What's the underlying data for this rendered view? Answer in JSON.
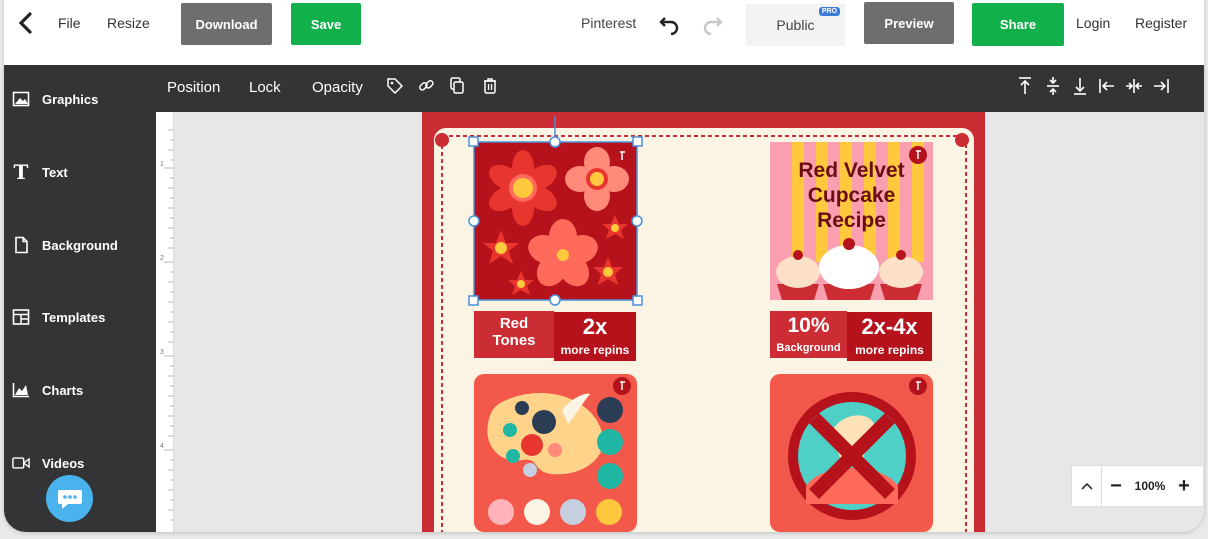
{
  "header": {
    "file": "File",
    "resize": "Resize",
    "download": "Download",
    "save": "Save",
    "platform": "Pinterest",
    "visibility": "Public",
    "pro_badge": "PRO",
    "preview": "Preview",
    "share": "Share",
    "login": "Login",
    "register": "Register"
  },
  "toolbar": {
    "position": "Position",
    "lock": "Lock",
    "opacity": "Opacity"
  },
  "sidebar": {
    "items": [
      {
        "label": "Graphics",
        "icon": "image-icon"
      },
      {
        "label": "Text",
        "icon": "text-icon"
      },
      {
        "label": "Background",
        "icon": "page-icon"
      },
      {
        "label": "Templates",
        "icon": "layout-icon"
      },
      {
        "label": "Charts",
        "icon": "chart-icon"
      },
      {
        "label": "Videos",
        "icon": "video-icon"
      }
    ]
  },
  "ruler": {
    "marks": [
      "1",
      "2",
      "3",
      "4"
    ]
  },
  "design": {
    "tiles": [
      {
        "label_left": "Red\nTones",
        "label_right_big": "2x",
        "label_right_small": "more repins"
      },
      {
        "title_lines": [
          "Red Velvet",
          "Cupcake",
          "Recipe"
        ],
        "label_left_big": "10%",
        "label_left_small": "Background",
        "label_right_big": "2x-4x",
        "label_right_small": "more repins"
      }
    ]
  },
  "zoom": {
    "value": "100%",
    "minus": "−",
    "plus": "+"
  },
  "colors": {
    "brand_green": "#11b04b",
    "dark_toolbar": "#333436",
    "design_red": "#cc2c33",
    "cream": "#fbf4e4"
  }
}
